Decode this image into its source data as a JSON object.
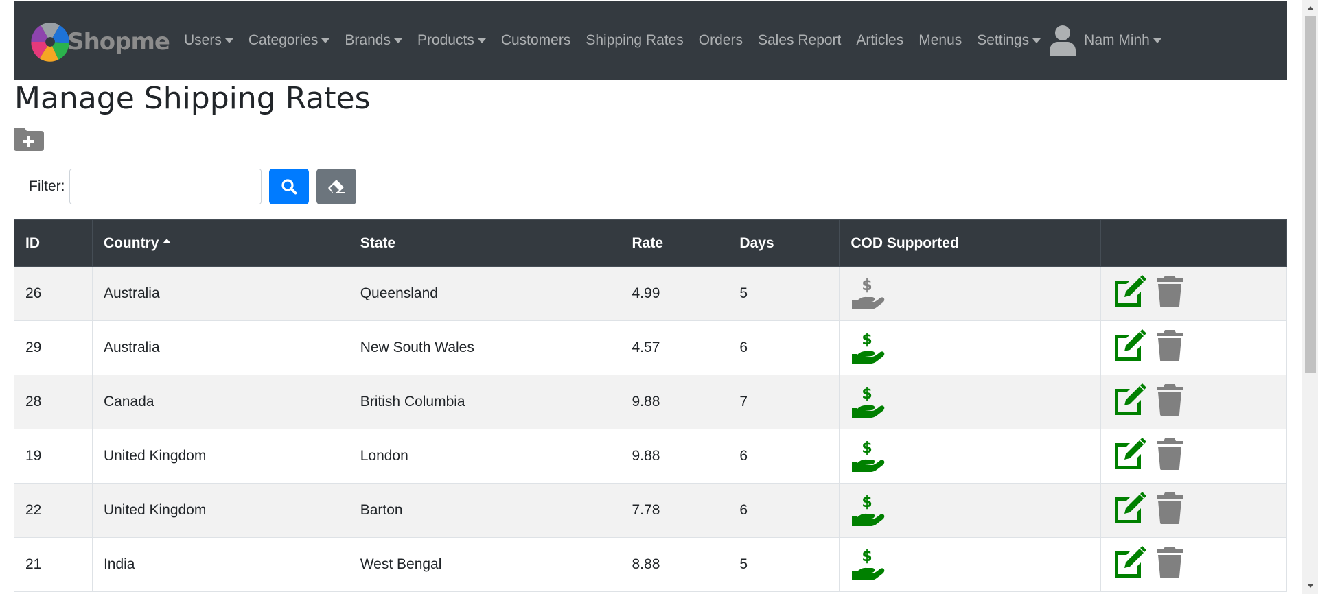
{
  "navbar": {
    "brand": "Shopme",
    "items": [
      {
        "label": "Users",
        "dropdown": true
      },
      {
        "label": "Categories",
        "dropdown": true
      },
      {
        "label": "Brands",
        "dropdown": true
      },
      {
        "label": "Products",
        "dropdown": true
      },
      {
        "label": "Customers",
        "dropdown": false
      },
      {
        "label": "Shipping Rates",
        "dropdown": false
      },
      {
        "label": "Orders",
        "dropdown": false
      },
      {
        "label": "Sales Report",
        "dropdown": false
      },
      {
        "label": "Articles",
        "dropdown": false
      },
      {
        "label": "Menus",
        "dropdown": false
      },
      {
        "label": "Settings",
        "dropdown": true
      }
    ],
    "user": {
      "name": "Nam Minh",
      "icon": "user-icon"
    }
  },
  "page": {
    "title": "Manage Shipping Rates",
    "new_button_icon": "folder-plus-icon"
  },
  "filter": {
    "label": "Filter:",
    "value": "",
    "placeholder": "",
    "search_icon": "search-icon",
    "clear_icon": "eraser-icon"
  },
  "table": {
    "headers": {
      "id": "ID",
      "country": "Country",
      "state": "State",
      "rate": "Rate",
      "days": "Days",
      "cod": "COD Supported",
      "actions": ""
    },
    "sort": {
      "column": "country",
      "direction": "asc"
    },
    "rows": [
      {
        "id": "26",
        "country": "Australia",
        "state": "Queensland",
        "rate": "4.99",
        "days": "5",
        "cod": false
      },
      {
        "id": "29",
        "country": "Australia",
        "state": "New South Wales",
        "rate": "4.57",
        "days": "6",
        "cod": true
      },
      {
        "id": "28",
        "country": "Canada",
        "state": "British Columbia",
        "rate": "9.88",
        "days": "7",
        "cod": true
      },
      {
        "id": "19",
        "country": "United Kingdom",
        "state": "London",
        "rate": "9.88",
        "days": "6",
        "cod": true
      },
      {
        "id": "22",
        "country": "United Kingdom",
        "state": "Barton",
        "rate": "7.78",
        "days": "6",
        "cod": true
      },
      {
        "id": "21",
        "country": "India",
        "state": "West Bengal",
        "rate": "8.88",
        "days": "5",
        "cod": true
      }
    ]
  },
  "colors": {
    "navbar_bg": "#343a40",
    "cod_on": "#008000",
    "cod_off": "#808080",
    "edit": "#008000",
    "delete": "#808080",
    "search_button": "#007bff",
    "clear_button": "#6c757d"
  }
}
